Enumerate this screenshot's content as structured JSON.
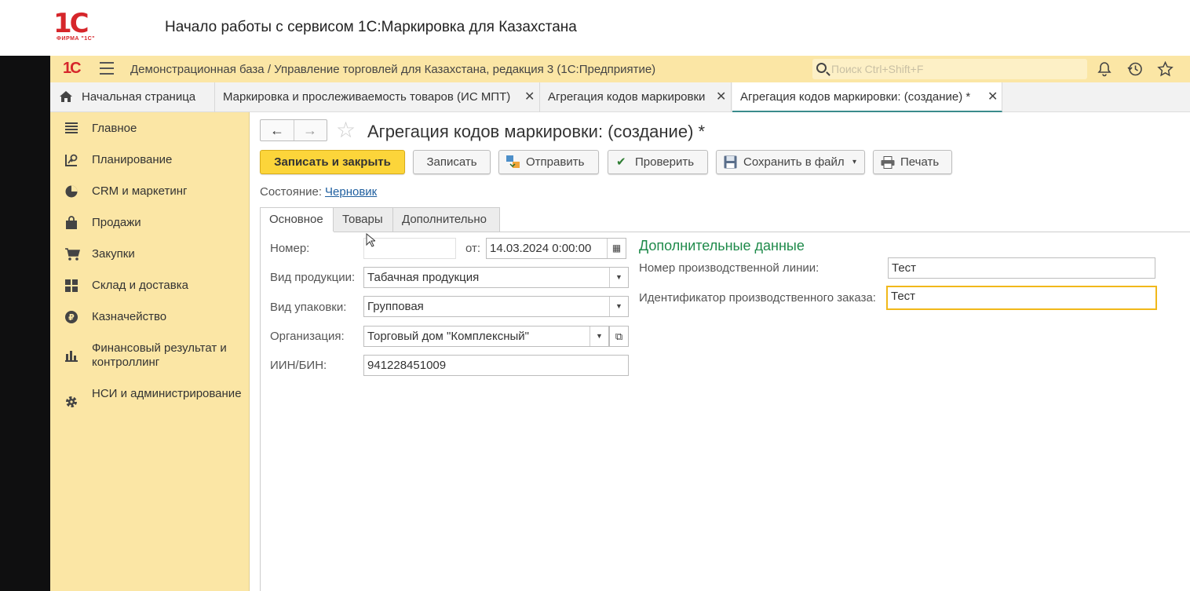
{
  "video_header": {
    "logo_text": "1С",
    "logo_sub": "ФИРМА \"1С\"",
    "title": "Начало работы с сервисом 1С:Маркировка для Казахстана"
  },
  "appbar": {
    "logo": "1С",
    "title": "Демонстрационная база / Управление торговлей для Казахстана, редакция 3  (1С:Предприятие)",
    "search_placeholder": "Поиск Ctrl+Shift+F",
    "icons": [
      "bell-icon",
      "history-icon",
      "star-icon"
    ]
  },
  "tabs": [
    {
      "label": "Начальная страница",
      "closable": false
    },
    {
      "label": "Маркировка и прослеживаемость товаров (ИС МПТ)",
      "closable": true
    },
    {
      "label": "Агрегация кодов маркировки",
      "closable": true
    },
    {
      "label": "Агрегация кодов маркировки:  (создание) *",
      "closable": true,
      "active": true
    }
  ],
  "sidebar": {
    "items": [
      {
        "label": "Главное",
        "icon": "list-icon"
      },
      {
        "label": "Планирование",
        "icon": "planning-icon"
      },
      {
        "label": "CRM и маркетинг",
        "icon": "pie-icon"
      },
      {
        "label": "Продажи",
        "icon": "bag-icon"
      },
      {
        "label": "Закупки",
        "icon": "cart-icon"
      },
      {
        "label": "Склад и доставка",
        "icon": "warehouse-icon"
      },
      {
        "label": "Казначейство",
        "icon": "coin-icon"
      },
      {
        "label": "Финансовый результат и контроллинг",
        "icon": "bar-chart-icon"
      },
      {
        "label": "НСИ и администрирование",
        "icon": "gear-icon"
      }
    ]
  },
  "document": {
    "title": "Агрегация кодов маркировки:  (создание) *",
    "buttons": {
      "save_close": "Записать и закрыть",
      "save": "Записать",
      "send": "Отправить",
      "check": "Проверить",
      "save_file": "Сохранить в файл",
      "print": "Печать"
    },
    "state_label": "Состояние:",
    "state_value": "Черновик",
    "form_tabs": [
      "Основное",
      "Товары",
      "Дополнительно"
    ],
    "fields": {
      "number_label": "Номер:",
      "number_value": "",
      "date_label": "от:",
      "date_value": "14.03.2024  0:00:00",
      "product_type_label": "Вид продукции:",
      "product_type_value": "Табачная продукция",
      "package_type_label": "Вид упаковки:",
      "package_type_value": "Групповая",
      "org_label": "Организация:",
      "org_value": "Торговый дом \"Комплексный\"",
      "iin_label": "ИИН/БИН:",
      "iin_value": "941228451009"
    },
    "extra": {
      "title": "Дополнительные данные",
      "line_label": "Номер производственной линии:",
      "line_value": "Тест",
      "order_label": "Идентификатор производственного заказа:",
      "order_value": "Тест"
    }
  }
}
